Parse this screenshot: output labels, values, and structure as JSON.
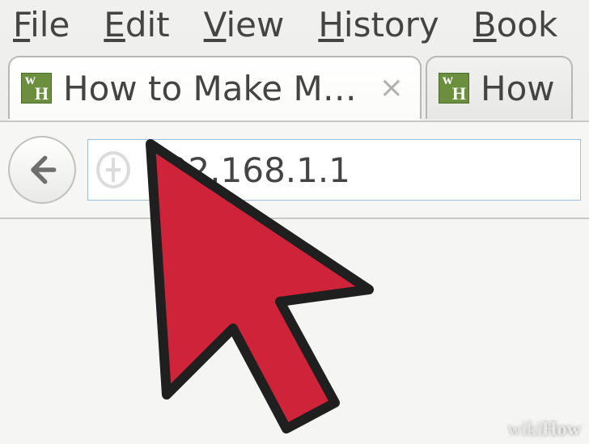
{
  "menubar": {
    "file": {
      "hot": "F",
      "rest": "ile"
    },
    "edit": {
      "hot": "E",
      "rest": "dit"
    },
    "view": {
      "hot": "V",
      "rest": "iew"
    },
    "history": {
      "hot": "H",
      "rest": "istory"
    },
    "book": {
      "hot": "B",
      "rest": "ook"
    }
  },
  "tabs": {
    "active": {
      "title": "How to Make M…",
      "close_glyph": "×"
    },
    "inactive": {
      "title": "How"
    }
  },
  "address_bar": {
    "url": "192.168.1.1"
  },
  "watermark": {
    "wiki": "wiki",
    "how": "How"
  },
  "colors": {
    "arrow_fill": "#cf2339",
    "arrow_stroke": "#1f1f1f",
    "favicon_bg": "#6b8f3e"
  }
}
